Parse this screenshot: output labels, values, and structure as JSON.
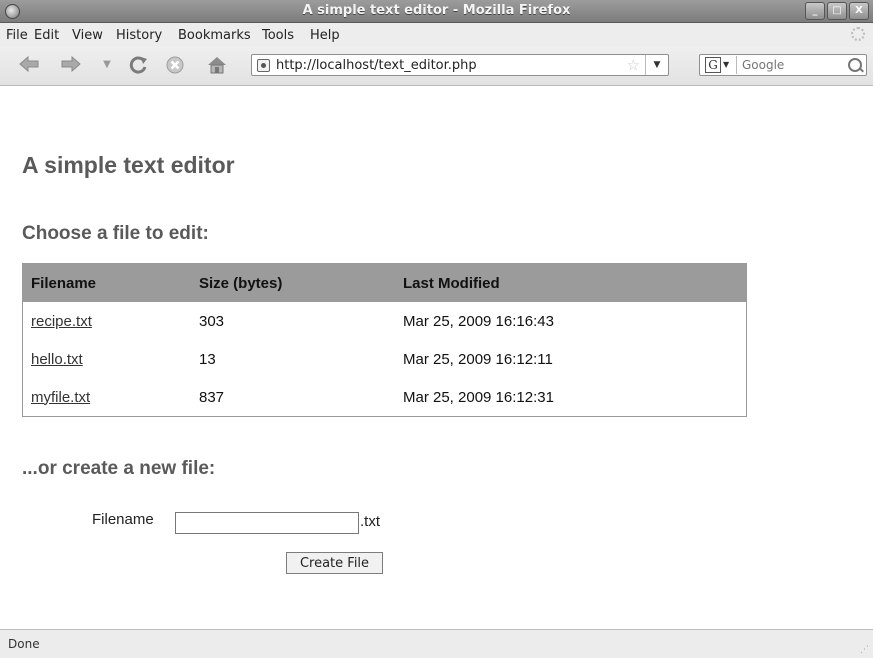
{
  "window": {
    "title": "A simple text editor - Mozilla Firefox",
    "buttons": {
      "minimize": "_",
      "maximize": "□",
      "close": "X"
    }
  },
  "menubar": {
    "items": [
      "File",
      "Edit",
      "View",
      "History",
      "Bookmarks",
      "Tools",
      "Help"
    ]
  },
  "navbar": {
    "url": "http://localhost/text_editor.php",
    "search_placeholder": "Google",
    "search_engine_letter": "G",
    "icons": [
      "back-icon",
      "forward-icon",
      "history-dropdown-icon",
      "reload-icon",
      "stop-icon",
      "home-icon"
    ]
  },
  "page": {
    "title": "A simple text editor",
    "choose_heading": "Choose a file to edit:",
    "table": {
      "headers": [
        "Filename",
        "Size (bytes)",
        "Last Modified"
      ],
      "rows": [
        {
          "filename": "recipe.txt",
          "size": "303",
          "modified": "Mar 25, 2009 16:16:43"
        },
        {
          "filename": "hello.txt",
          "size": "13",
          "modified": "Mar 25, 2009 16:12:11"
        },
        {
          "filename": "myfile.txt",
          "size": "837",
          "modified": "Mar 25, 2009 16:12:31"
        }
      ]
    },
    "create_heading": "...or create a new file:",
    "form": {
      "filename_label": "Filename",
      "filename_value": "",
      "extension": ".txt",
      "create_button": "Create File"
    }
  },
  "status": {
    "text": "Done"
  },
  "colors": {
    "titlebar": "#8a8a8a",
    "table_header": "#9b9b9b",
    "heading": "#5a5a5a"
  }
}
